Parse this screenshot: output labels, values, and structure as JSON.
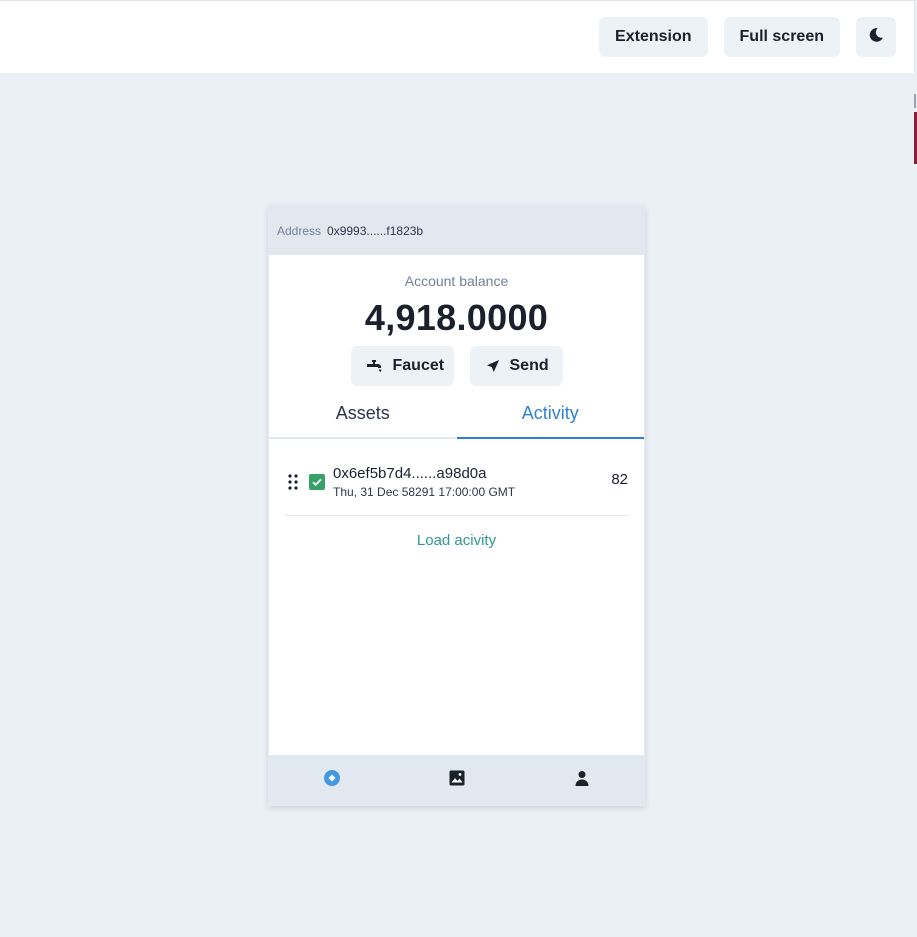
{
  "topbar": {
    "extension_label": "Extension",
    "fullscreen_label": "Full screen",
    "theme_icon": "moon-icon"
  },
  "wallet": {
    "address_label": "Address",
    "address_value": "0x9993......f1823b",
    "balance_label": "Account balance",
    "balance_value": "4,918.0000",
    "actions": {
      "faucet_label": "Faucet",
      "faucet_icon": "faucet-icon",
      "send_label": "Send",
      "send_icon": "send-icon"
    },
    "tabs": [
      {
        "label": "Assets",
        "active": false
      },
      {
        "label": "Activity",
        "active": true
      }
    ],
    "activity": [
      {
        "hash": "0x6ef5b7d4......a98d0a",
        "time": "Thu, 31 Dec 58291 17:00:00 GMT",
        "amount": "82",
        "status": "success"
      }
    ],
    "load_activity_label": "Load acivity",
    "footer_nav": [
      "wallet-icon",
      "image-icon",
      "user-icon"
    ]
  },
  "colors": {
    "accent": "#3182ce",
    "success": "#38a169",
    "link": "#319795",
    "background": "#ebf0f5"
  }
}
